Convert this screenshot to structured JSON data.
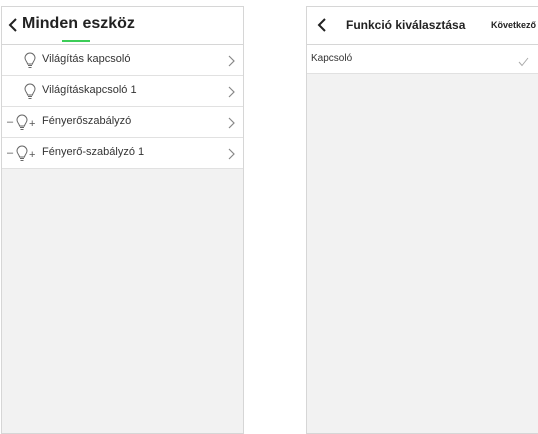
{
  "left": {
    "title": "Minden eszköz",
    "items": [
      {
        "label": "Világítás kapcsoló",
        "icon": "bulb-icon"
      },
      {
        "label": "Világításkapcsoló 1",
        "icon": "bulb-icon"
      },
      {
        "label": "Fényerőszabályzó",
        "icon": "dimmer-bulb-icon"
      },
      {
        "label": "Fényerő-szabályzó 1",
        "icon": "dimmer-bulb-icon"
      }
    ]
  },
  "right": {
    "title": "Funkció kiválasztása",
    "next_label": "Következő",
    "options": [
      {
        "label": "Kapcsoló",
        "selected": true
      }
    ]
  },
  "colors": {
    "accent": "#3dcd58",
    "panel_bg": "#f2f2f2",
    "border": "#d6d6d6"
  }
}
